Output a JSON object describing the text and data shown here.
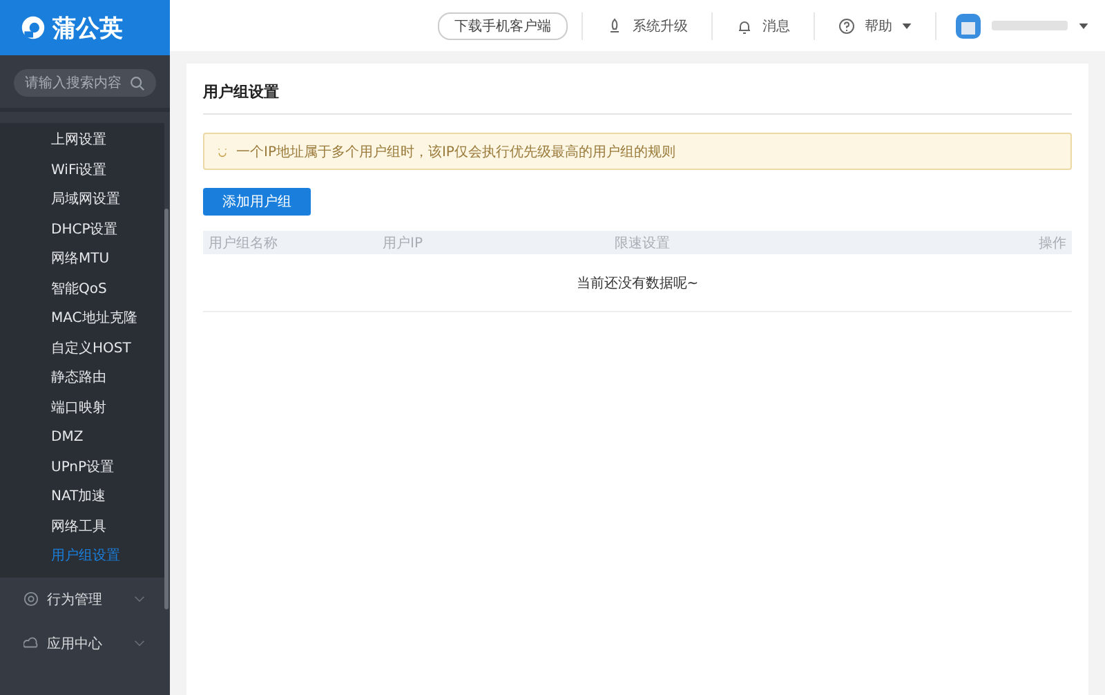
{
  "brand": {
    "name": "蒲公英"
  },
  "topbar": {
    "download": "下载手机客户端",
    "items": [
      {
        "kind": "upgrade",
        "label": "系统升级"
      },
      {
        "kind": "bell",
        "label": "消息"
      },
      {
        "kind": "help",
        "label": "帮助"
      }
    ]
  },
  "sidebar": {
    "search": {
      "placeholder": "请输入搜索内容"
    },
    "items": [
      {
        "label": "上网设置",
        "selected": false
      },
      {
        "label": "WiFi设置",
        "selected": false
      },
      {
        "label": "局域网设置",
        "selected": false
      },
      {
        "label": "DHCP设置",
        "selected": false
      },
      {
        "label": "网络MTU",
        "selected": false
      },
      {
        "label": "智能QoS",
        "selected": false
      },
      {
        "label": "MAC地址克隆",
        "selected": false
      },
      {
        "label": "自定义HOST",
        "selected": false
      },
      {
        "label": "静态路由",
        "selected": false
      },
      {
        "label": "端口映射",
        "selected": false
      },
      {
        "label": "DMZ",
        "selected": false
      },
      {
        "label": "UPnP设置",
        "selected": false
      },
      {
        "label": "NAT加速",
        "selected": false
      },
      {
        "label": "网络工具",
        "selected": false
      },
      {
        "label": "用户组设置",
        "selected": true
      }
    ],
    "groups": [
      {
        "kind": "behavior",
        "label": "行为管理",
        "expanded": false
      },
      {
        "kind": "apps",
        "label": "应用中心",
        "expanded": false
      }
    ]
  },
  "page": {
    "title": "用户组设置",
    "notice": "一个IP地址属于多个用户组时，该IP仅会执行优先级最高的用户组的规则",
    "add_button": "添加用户组",
    "table": {
      "columns": [
        "用户组名称",
        "用户IP",
        "限速设置",
        "操作"
      ],
      "empty": "当前还没有数据呢~"
    }
  }
}
